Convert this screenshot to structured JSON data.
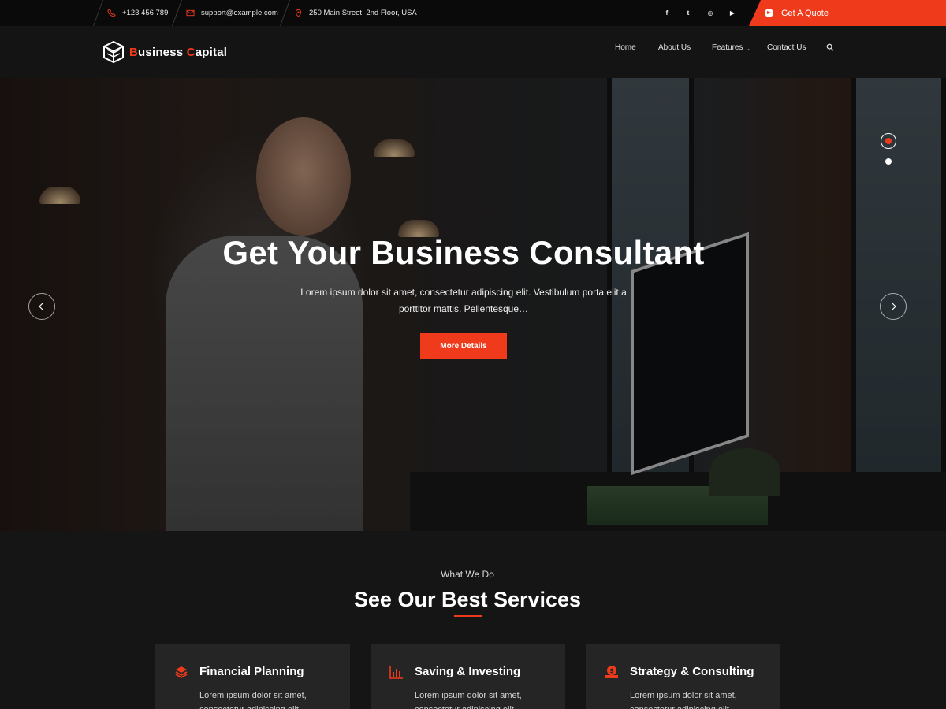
{
  "colors": {
    "accent": "#ef3a1c",
    "topbar": "#0a0a0a",
    "header": "#141414",
    "card": "#252525"
  },
  "topbar": {
    "phone": "+123 456 789",
    "email": "support@example.com",
    "address": "250 Main Street, 2nd Floor, USA",
    "social": [
      {
        "icon": "facebook-icon",
        "glyph": "f"
      },
      {
        "icon": "twitter-icon",
        "glyph": "t"
      },
      {
        "icon": "instagram-icon",
        "glyph": "◎"
      },
      {
        "icon": "youtube-icon",
        "glyph": "▶"
      }
    ],
    "quote_label": "Get A Quote"
  },
  "header": {
    "logo_first_letter": "B",
    "logo_first_rest": "usiness ",
    "logo_second_letter": "C",
    "logo_second_rest": "apital",
    "nav": [
      {
        "label": "Home"
      },
      {
        "label": "About Us"
      },
      {
        "label": "Features",
        "has_dropdown": true
      },
      {
        "label": "Contact Us"
      }
    ],
    "search_icon": "search-icon"
  },
  "hero": {
    "title": "Get Your Business Consultant",
    "description": "Lorem ipsum dolor sit amet, consectetur adipiscing elit. Vestibulum porta elit a porttitor mattis. Pellentesque…",
    "button_label": "More Details",
    "slide_count": 2,
    "active_slide": 1
  },
  "services": {
    "eyebrow": "What We Do",
    "title": "See Our Best Services",
    "cards": [
      {
        "icon": "layers-icon",
        "title": "Financial Planning",
        "text": "Lorem ipsum dolor sit amet, consectetur adipiscing elit."
      },
      {
        "icon": "bar-chart-icon",
        "title": "Saving & Investing",
        "text": "Lorem ipsum dolor sit amet, consectetur adipiscing elit."
      },
      {
        "icon": "money-bag-icon",
        "title": "Strategy & Consulting",
        "text": "Lorem ipsum dolor sit amet, consectetur adipiscing elit."
      }
    ]
  }
}
